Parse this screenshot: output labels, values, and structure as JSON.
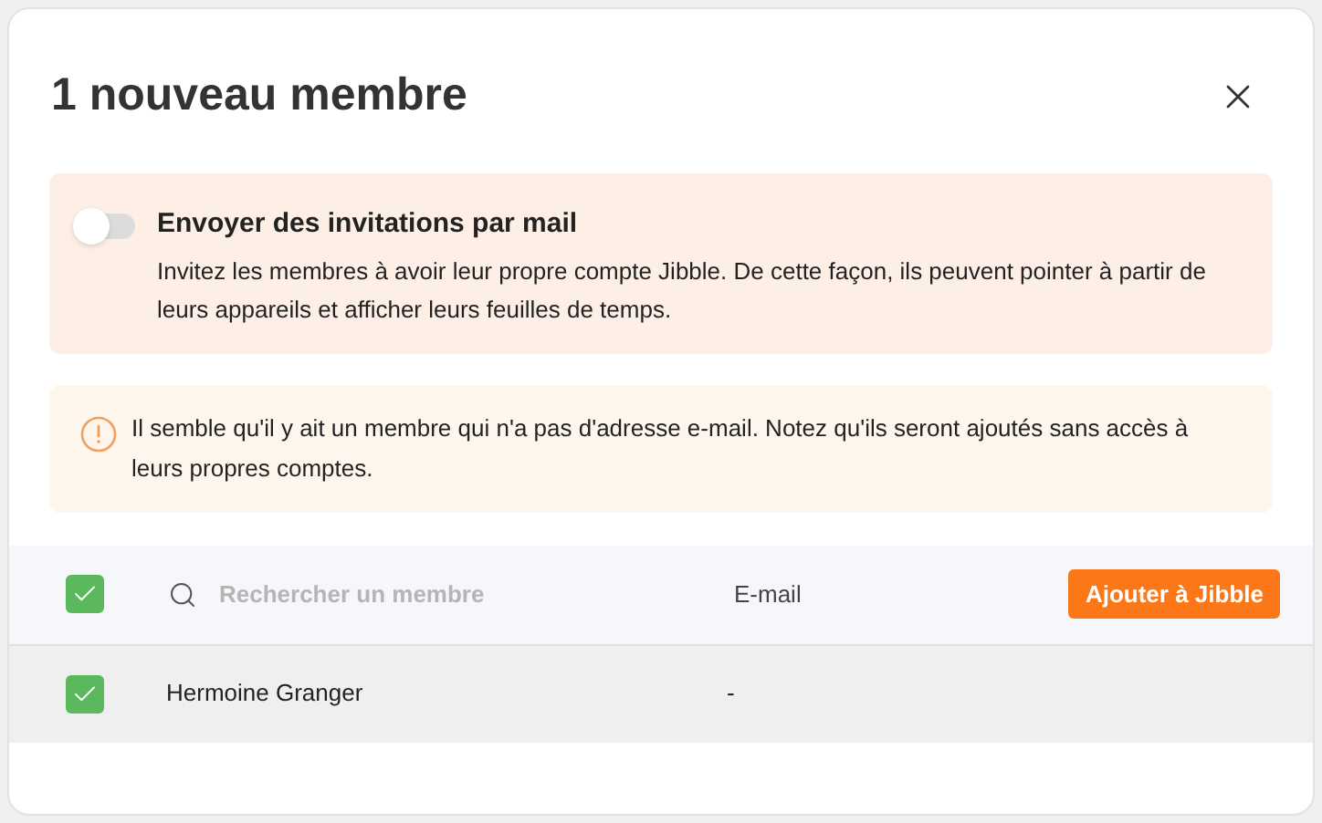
{
  "dialog": {
    "title": "1 nouveau membre"
  },
  "invite": {
    "on": false,
    "title": "Envoyer des invitations par mail",
    "description": "Invitez les membres à avoir leur propre compte Jibble. De cette façon, ils peuvent pointer à partir de leurs appareils et afficher leurs feuilles de temps."
  },
  "warning": {
    "text": "Il semble qu'il y ait un membre qui n'a pas d'adresse e-mail. Notez qu'ils seront ajoutés sans accès à leurs propres comptes."
  },
  "table": {
    "select_all": {
      "checked": true
    },
    "search": {
      "placeholder": "Rechercher un membre"
    },
    "email_header": "E-mail",
    "add_button": "Ajouter à Jibble",
    "rows": [
      {
        "checked": true,
        "name": "Hermoine Granger",
        "email": "-"
      }
    ]
  }
}
